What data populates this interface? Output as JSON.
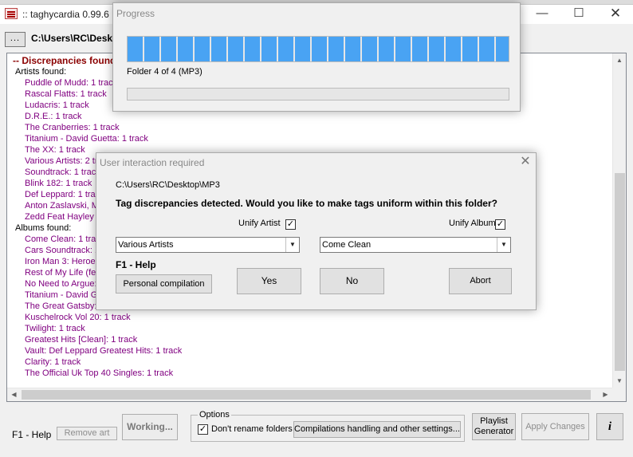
{
  "window": {
    "title": ":: taghycardia 0.99.6 :: folders & tags normalizer :: written by electronutsie ::",
    "path": "C:\\Users\\RC\\Desktop\\MP3"
  },
  "path_row": {
    "browse_label": "..."
  },
  "results": {
    "heading": "-- Discrepancies found --",
    "artists_header": "Artists found:",
    "artists": [
      "Puddle of Mudd: 1 track",
      "Rascal Flatts: 1 track",
      "Ludacris: 1 track",
      "D.R.E.: 1 track",
      "The Cranberries: 1 track",
      "Titanium - David Guetta: 1 track",
      "The XX: 1 track",
      "Various Artists: 2 tracks",
      "Soundtrack: 1 track",
      "Blink 182: 1 track",
      "Def Leppard: 1 track",
      "Anton Zaslavski, Matthew Koma: 1 track",
      "Zedd Feat Hayley Williams: 1 track"
    ],
    "albums_header": "Albums found:",
    "albums": [
      "Come Clean: 1 track",
      "Cars Soundtrack: 1 track",
      "Iron Man 3: Heroes Fall (Music Inspired By the Motion Picture): 1 track",
      "Rest of My Life (feat. Usher & David Guetta) - Single: 1 track",
      "No Need to Argue: 1 track",
      "Titanium - David Guetta: 1 track",
      "The Great Gatsby: 1 track",
      "Kuschelrock Vol 20: 1 track",
      "Twilight: 1 track",
      "Greatest Hits [Clean]: 1 track",
      "Vault: Def Leppard Greatest Hits: 1 track",
      "Clarity: 1 track",
      "The Official Uk Top 40 Singles: 1 track"
    ]
  },
  "toolbar": {
    "f1_help": "F1 - Help",
    "remove_art": "Remove art",
    "working": "Working...",
    "options_legend": "Options",
    "dont_rename": "Don't rename folders",
    "dont_rename_checked": true,
    "compilations": "Compilations handling and other settings...",
    "playlist_line1": "Playlist",
    "playlist_line2": "Generator",
    "apply_changes": "Apply Changes",
    "info": "i"
  },
  "progress": {
    "title": "Progress",
    "status": "Folder 4 of 4 (MP3)",
    "bar1_fraction": 1.0,
    "bar2_fraction": 0.0
  },
  "dialog": {
    "title": "User interaction required",
    "path": "C:\\Users\\RC\\Desktop\\MP3",
    "question": "Tag discrepancies detected. Would you like to make tags uniform within this folder?",
    "unify_artist_label": "Unify Artist",
    "unify_artist_checked": true,
    "unify_album_label": "Unify Album",
    "unify_album_checked": true,
    "artist_value": "Various Artists",
    "album_value": "Come Clean",
    "f1_help": "F1 - Help",
    "personal_compilation": "Personal compilation",
    "yes": "Yes",
    "no": "No",
    "abort": "Abort"
  },
  "colors": {
    "heading": "#8b0000",
    "entry": "#800080",
    "progress_fill": "#49a3f3"
  },
  "icons": {
    "app": "app-icon",
    "minimize": "minimize-icon",
    "maximize": "maximize-icon",
    "close": "close-icon",
    "dialog_close": "close-icon",
    "dropdown": "chevron-down-icon",
    "checkmark": "checkmark-icon"
  }
}
